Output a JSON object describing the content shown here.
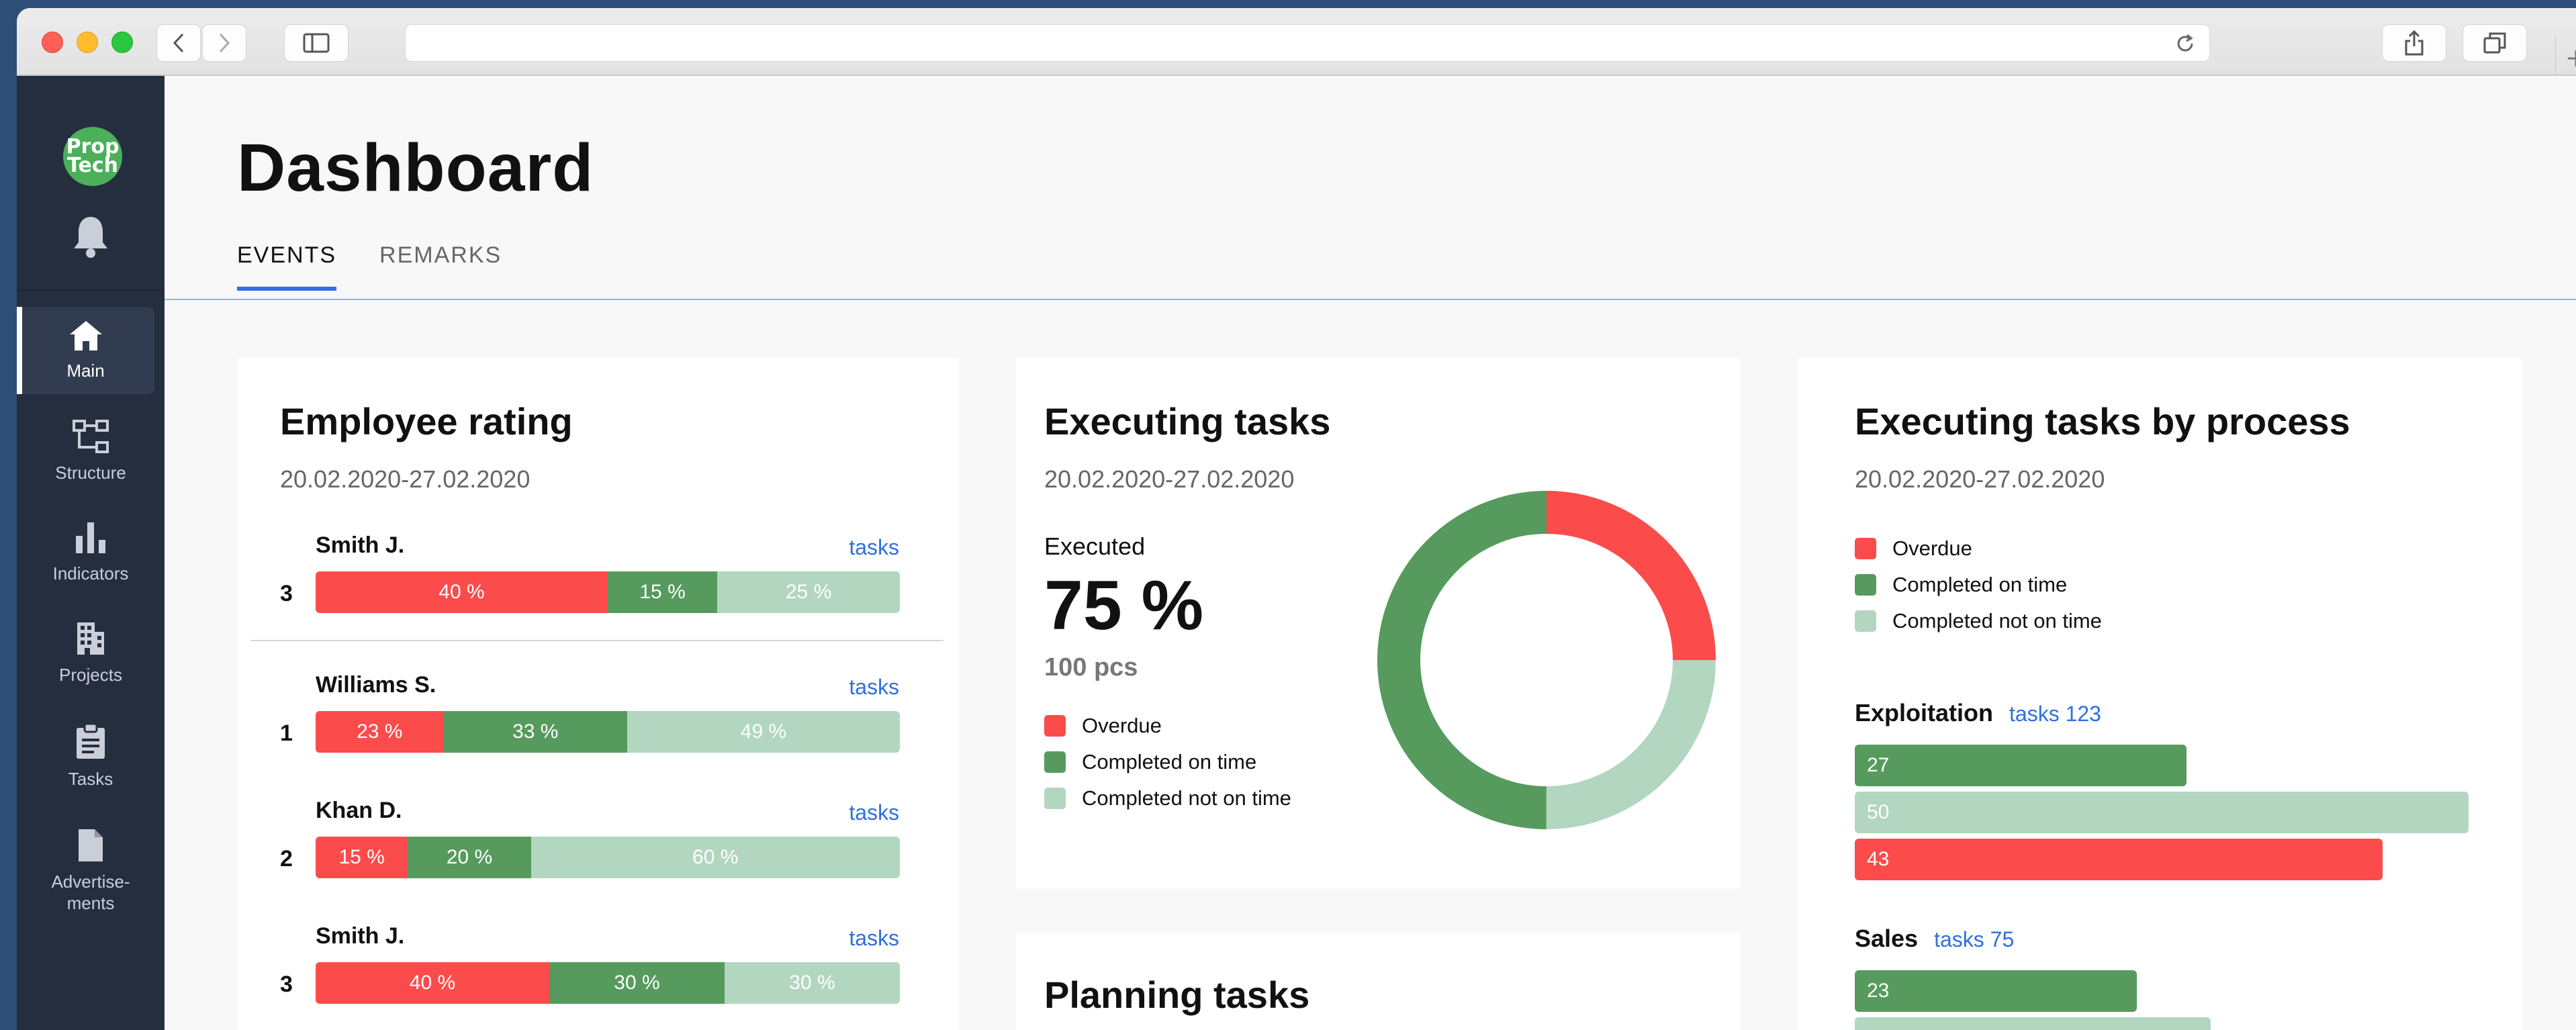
{
  "browser": {
    "back_icon": "chevron-left-icon",
    "forward_icon": "chevron-right-icon",
    "sidebar_toggle_icon": "sidebar-icon",
    "reload_icon": "reload-icon",
    "share_icon": "share-icon",
    "tabs_icon": "tabs-icon",
    "new_tab_icon": "plus-icon"
  },
  "sidebar": {
    "logo_line1": "Prop",
    "logo_line2": "Tech",
    "bell_icon": "bell-icon",
    "items": [
      {
        "label": "Main",
        "icon": "home-icon",
        "active": true
      },
      {
        "label": "Structure",
        "icon": "structure-icon"
      },
      {
        "label": "Indicators",
        "icon": "bar-chart-icon"
      },
      {
        "label": "Projects",
        "icon": "building-icon"
      },
      {
        "label": "Tasks",
        "icon": "clipboard-icon"
      },
      {
        "label_line1": "Advertise-",
        "label_line2": "ments",
        "icon": "document-icon"
      }
    ]
  },
  "page": {
    "title": "Dashboard",
    "tabs": [
      {
        "label": "EVENTS",
        "active": true
      },
      {
        "label": "REMARKS"
      }
    ]
  },
  "colors": {
    "overdue": "#fc4b4b",
    "on_time": "#569b5d",
    "not_on_time": "#b3d6c0",
    "accent": "#2f6fe0"
  },
  "employee_rating": {
    "title": "Employee rating",
    "date_range": "20.02.2020-27.02.2020",
    "rows": [
      {
        "name": "Smith J.",
        "rank": "3",
        "link": "tasks",
        "overdue": "40 %",
        "on_time": "15 %",
        "not_on_time": "25 %",
        "w": [
          40,
          15,
          25
        ]
      },
      {
        "name": "Williams S.",
        "rank": "1",
        "link": "tasks",
        "overdue": "23 %",
        "on_time": "33 %",
        "not_on_time": "49 %",
        "w": [
          23,
          33,
          49
        ]
      },
      {
        "name": "Khan D.",
        "rank": "2",
        "link": "tasks",
        "overdue": "15 %",
        "on_time": "20 %",
        "not_on_time": "60 %",
        "w": [
          15,
          20,
          60
        ]
      },
      {
        "name": "Smith J.",
        "rank": "3",
        "link": "tasks",
        "overdue": "40 %",
        "on_time": "30 %",
        "not_on_time": "30 %",
        "w": [
          40,
          30,
          30
        ]
      }
    ]
  },
  "executing_tasks": {
    "title": "Executing tasks",
    "date_range": "20.02.2020-27.02.2020",
    "executed_label": "Executed",
    "executed_pct": "75 %",
    "count": "100 pcs",
    "legend": [
      "Overdue",
      "Completed on time",
      "Completed not on time"
    ],
    "donut": {
      "overdue": 25,
      "not_on_time": 25,
      "on_time": 50
    }
  },
  "planning_tasks": {
    "title": "Planning tasks"
  },
  "tasks_by_process": {
    "title": "Executing tasks by process",
    "date_range": "20.02.2020-27.02.2020",
    "legend": [
      "Overdue",
      "Completed on time",
      "Completed not on time"
    ],
    "groups": [
      {
        "name": "Exploitation",
        "tasks": "tasks 123",
        "bars": [
          {
            "value": "27",
            "kind": "on_time"
          },
          {
            "value": "50",
            "kind": "not_on_time"
          },
          {
            "value": "43",
            "kind": "overdue"
          }
        ]
      },
      {
        "name": "Sales",
        "tasks": "tasks 75",
        "bars": [
          {
            "value": "23",
            "kind": "on_time"
          },
          {
            "value": "29",
            "kind": "not_on_time"
          }
        ]
      }
    ]
  }
}
